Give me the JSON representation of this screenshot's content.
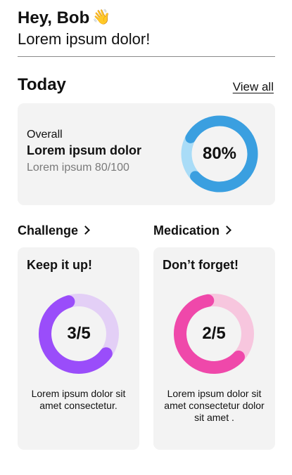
{
  "header": {
    "greeting": "Hey, Bob",
    "wave": "👋",
    "subtitle": "Lorem ipsum dolor!"
  },
  "today": {
    "title": "Today",
    "view_all": "View all",
    "overall": {
      "label": "Overall",
      "title": "Lorem ipsum dolor",
      "subtitle": "Lorem ipsum 80/100",
      "progress_text": "80%",
      "progress": 0.8,
      "color": "#3a9fe0",
      "track_color": "#a9dcf7"
    }
  },
  "challenge": {
    "title": "Challenge",
    "heading": "Keep it up!",
    "progress_text": "3/5",
    "progress": 0.6,
    "color": "#9a4dfa",
    "track_color": "#e3cff6",
    "footer": "Lorem ipsum dolor sit amet consectetur."
  },
  "medication": {
    "title": "Medication",
    "heading": "Don’t forget!",
    "progress_text": "2/5",
    "progress": 0.6,
    "color": "#ef48aa",
    "track_color": "#f7c6de",
    "footer": "Lorem ipsum dolor sit amet consectetur dolor sit amet ."
  }
}
